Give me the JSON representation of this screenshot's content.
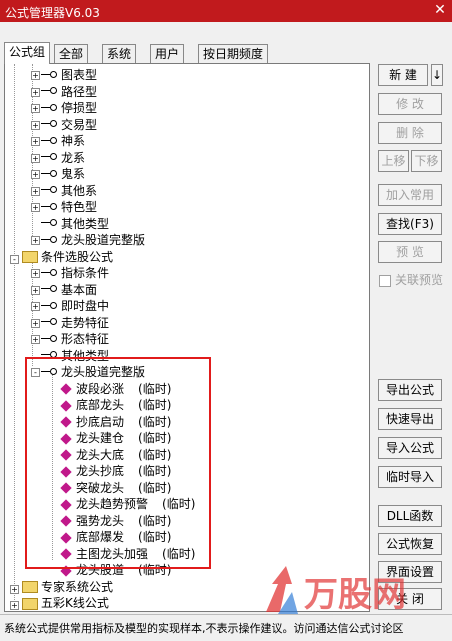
{
  "window": {
    "title": "公式管理器V6.03",
    "close_glyph": "✕"
  },
  "tabs": [
    "公式组",
    "全部",
    "系统",
    "用户",
    "按日期频度"
  ],
  "tree": {
    "group1_items": [
      "图表型",
      "路径型",
      "停损型",
      "交易型",
      "神系",
      "龙系",
      "鬼系",
      "其他系",
      "特色型",
      "其他类型",
      "龙头股道完整版"
    ],
    "group2_label": "条件选股公式",
    "group2_items": [
      "指标条件",
      "基本面",
      "即时盘中",
      "走势特征",
      "形态特征",
      "其他类型"
    ],
    "group3_label": "龙头股道完整版",
    "group3_items": [
      {
        "name": "波段必涨",
        "tag": "(临时)"
      },
      {
        "name": "底部龙头",
        "tag": "(临时)"
      },
      {
        "name": "抄底启动",
        "tag": "(临时)"
      },
      {
        "name": "龙头建仓",
        "tag": "(临时)"
      },
      {
        "name": "龙头大底",
        "tag": "(临时)"
      },
      {
        "name": "龙头抄底",
        "tag": "(临时)"
      },
      {
        "name": "突破龙头",
        "tag": "(临时)"
      },
      {
        "name": "龙头趋势预警",
        "tag": "(临时)"
      },
      {
        "name": "强势龙头",
        "tag": "(临时)"
      },
      {
        "name": "底部爆发",
        "tag": "(临时)"
      },
      {
        "name": "主图龙头加强",
        "tag": "(临时)"
      },
      {
        "name": "龙头股道",
        "tag": "(临时)"
      }
    ],
    "group4_label": "专家系统公式",
    "group5_label": "五彩K线公式"
  },
  "buttons": {
    "new": "新 建",
    "new_arrow": "↓",
    "modify": "修 改",
    "delete": "删 除",
    "up": "上移",
    "down": "下移",
    "add_common": "加入常用",
    "find": "查找(F3)",
    "preview": "预 览",
    "link_preview": "关联预览",
    "export": "导出公式",
    "quick_export": "快速导出",
    "import": "导入公式",
    "temp_import": "临时导入",
    "dll": "DLL函数",
    "restore": "公式恢复",
    "ui_settings": "界面设置",
    "close": "关 闭"
  },
  "status_text": "系统公式提供常用指标及模型的实现样本,不表示操作建议。访问通达信公式讨论区",
  "watermark": {
    "text": "万股网",
    "colors": {
      "primary": "#e03030",
      "secondary": "#2e7bd6"
    }
  }
}
